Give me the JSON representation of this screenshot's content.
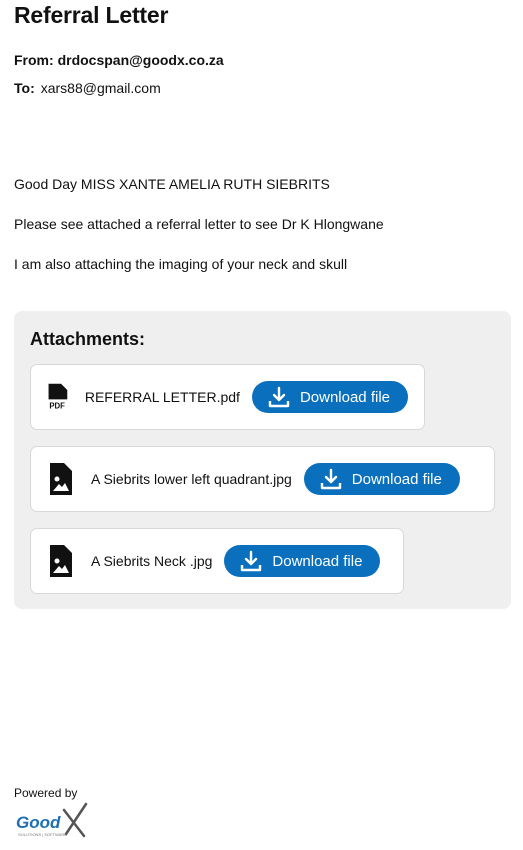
{
  "header": {
    "title": "Referral Letter"
  },
  "email": {
    "from_label": "From:",
    "from_value": "drdocspan@goodx.co.za",
    "to_label": "To:",
    "to_value": "xars88@gmail.com"
  },
  "body": {
    "greeting": "Good Day MISS XANTE AMELIA RUTH SIEBRITS",
    "line1": "Please see attached a referral letter to see Dr K Hlongwane",
    "line2": "I am also attaching the imaging of your neck and skull"
  },
  "attachments": {
    "title": "Attachments:",
    "files": [
      {
        "name": "REFERRAL LETTER.pdf",
        "icon": "pdf-file-icon",
        "button": "Download file"
      },
      {
        "name": "A Siebrits lower left quadrant.jpg",
        "icon": "image-file-icon",
        "button": "Download file"
      },
      {
        "name": "A Siebrits Neck .jpg",
        "icon": "image-file-icon",
        "button": "Download file"
      }
    ]
  },
  "footer": {
    "powered_by": "Powered by",
    "logo_text": "Good",
    "logo_tagline": "SOLUTIONS | SOFTWARE"
  },
  "colors": {
    "accent": "#0a70bd",
    "panel": "#efefef"
  }
}
